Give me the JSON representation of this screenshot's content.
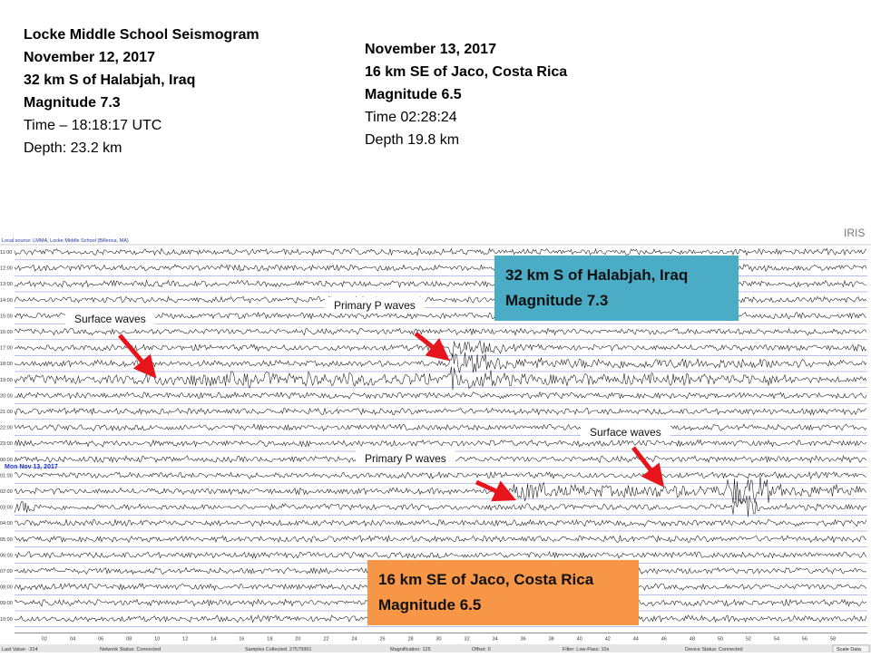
{
  "info_iraq": {
    "heading": "Locke Middle School Seismogram",
    "date": "November 12, 2017",
    "location": "32 km S of Halabjah,  Iraq",
    "magnitude": "Magnitude  7.3",
    "time": "Time – 18:18:17 UTC",
    "depth": "Depth: 23.2 km"
  },
  "info_costa": {
    "date": "November 13, 2017",
    "location": "16 km SE of Jaco, Costa Rica",
    "magnitude": "Magnitude  6.5",
    "time": "Time 02:28:24",
    "depth": "Depth 19.8 km"
  },
  "box_iraq": {
    "line1": "32 km S of Halabjah, Iraq",
    "line2": "Magnitude 7.3",
    "color": "#4bacc6"
  },
  "box_costa": {
    "line1": "16 km SE of Jaco, Costa Rica",
    "line2": "Magnitude 6.5",
    "color": "#f79646"
  },
  "annotations": {
    "surface_waves_1": "Surface waves",
    "primary_p_1": "Primary P waves",
    "primary_p_2": "Primary P waves",
    "surface_waves_2": "Surface waves"
  },
  "seismogram": {
    "source_label": "Local source: LMMA, Locke Middle School (Billerica, MA)",
    "logo": "IRIS",
    "date_marker": "Mon Nov 13, 2017",
    "hour_labels": [
      "11:00",
      "12:00",
      "13:00",
      "14:00",
      "15:00",
      "16:00",
      "17:00",
      "18:00",
      "19:00",
      "20:00",
      "21:00",
      "22:00",
      "23:00",
      "00:00",
      "01:00",
      "02:00",
      "03:00",
      "04:00",
      "05:00",
      "06:00",
      "07:00",
      "08:00",
      "09:00",
      "10:00"
    ],
    "minute_labels": [
      "02",
      "04",
      "06",
      "08",
      "10",
      "12",
      "14",
      "16",
      "18",
      "20",
      "22",
      "24",
      "26",
      "28",
      "30",
      "32",
      "34",
      "36",
      "38",
      "40",
      "42",
      "44",
      "46",
      "48",
      "50",
      "52",
      "54",
      "56",
      "58"
    ],
    "status": {
      "last_value": "Last Value: -314",
      "network": "Network Status: Connected",
      "samples": "Samples Collected: 27579991",
      "magnification": "Magnification: 125",
      "offset": "Offset: 0",
      "filter": "Filter: Low-Pass: 10s",
      "device": "Device Status: Connected",
      "scale_button": "Scale Data"
    }
  },
  "colors": {
    "arrow": "#e8141c",
    "trace": "#111111",
    "gridline": "#6f86d6"
  }
}
